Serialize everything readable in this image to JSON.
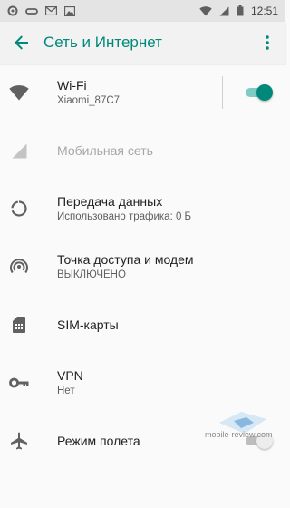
{
  "status_bar": {
    "time": "12:51",
    "left_icons": [
      "settings-icon",
      "cloud-link-icon",
      "gmail-icon",
      "image-icon"
    ],
    "right_icons": [
      "wifi-icon",
      "signal-icon",
      "battery-icon"
    ]
  },
  "app_bar": {
    "title": "Сеть и Интернет",
    "back_icon": "arrow-back-icon",
    "menu_icon": "more-vert-icon"
  },
  "colors": {
    "accent": "#00897b",
    "accent_light": "#80cbc4",
    "text_primary": "#212121",
    "text_secondary": "#5f5f5f",
    "text_disabled": "#a7a7a7"
  },
  "items": [
    {
      "icon": "wifi-icon",
      "title": "Wi-Fi",
      "subtitle": "Xiaomi_87C7",
      "toggle": "on"
    },
    {
      "icon": "cellular-icon",
      "title": "Мобильная сеть",
      "subtitle": "",
      "disabled": true
    },
    {
      "icon": "data-usage-icon",
      "title": "Передача данных",
      "subtitle": "Использовано трафика: 0 Б"
    },
    {
      "icon": "hotspot-icon",
      "title": "Точка доступа и модем",
      "subtitle": "ВЫКЛЮЧЕНО"
    },
    {
      "icon": "sim-card-icon",
      "title": "SIM-карты",
      "subtitle": ""
    },
    {
      "icon": "vpn-key-icon",
      "title": "VPN",
      "subtitle": "Нет"
    },
    {
      "icon": "airplane-icon",
      "title": "Режим полета",
      "subtitle": "",
      "toggle": "off"
    }
  ],
  "watermark": {
    "text": "mobile-review.com"
  }
}
